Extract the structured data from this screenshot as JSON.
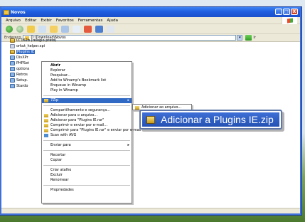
{
  "window": {
    "title": "Novos"
  },
  "titlebar_buttons": [
    "_",
    "□",
    "X"
  ],
  "menu": [
    "Arquivo",
    "Editar",
    "Exibir",
    "Favoritos",
    "Ferramentas",
    "Ajuda"
  ],
  "address": {
    "label": "Endereço",
    "value": "D:\\Download\\Novos",
    "go_label": "Ir"
  },
  "files": [
    {
      "name": "LC162b (relogio preto)",
      "icon": "zip-icon"
    },
    {
      "name": "orkut_helper.xpi",
      "icon": "xpi-icon"
    },
    {
      "name": "Plugins IE",
      "icon": "zip-icon",
      "selected": true
    },
    {
      "name": "DivXPr",
      "icon": "exe-icon"
    },
    {
      "name": "PHPSet",
      "icon": "exe-icon"
    },
    {
      "name": "options",
      "icon": "exe-icon"
    },
    {
      "name": "Retros",
      "icon": "exe-icon"
    },
    {
      "name": "Setup.",
      "icon": "exe-icon"
    },
    {
      "name": "Stardo",
      "icon": "exe-icon"
    }
  ],
  "context_menu": {
    "items": [
      {
        "label": "Abrir",
        "bold": true
      },
      {
        "label": "Explorar"
      },
      {
        "label": "Pesquisar..."
      },
      {
        "label": "Add to Winamp's Bookmark list"
      },
      {
        "label": "Enqueue in Winamp"
      },
      {
        "label": "Play in Winamp"
      },
      {
        "sep": true
      },
      {
        "label": "7Zip",
        "icon": "zip-icon",
        "arrow": "▸",
        "highlighted": true
      },
      {
        "sep": true
      },
      {
        "label": "Compartilhamento e segurança..."
      },
      {
        "label": "Adicionar para o arquivo...",
        "icon": "zip-icon"
      },
      {
        "label": "Adicionar para \"Plugins IE.rar\"",
        "icon": "zip-icon"
      },
      {
        "label": "Comprimir e enviar por e-mail...",
        "icon": "zip-icon"
      },
      {
        "label": "Comprimir para \"Plugins IE.rar\" e enviar por e-mail",
        "icon": "zip-icon"
      },
      {
        "label": "Scan with AVG",
        "icon": "scan-icon"
      },
      {
        "sep": true
      },
      {
        "label": "Enviar para",
        "arrow": "▸"
      },
      {
        "sep": true
      },
      {
        "label": "Recortar"
      },
      {
        "label": "Copiar"
      },
      {
        "sep": true
      },
      {
        "label": "Criar atalho"
      },
      {
        "label": "Excluir"
      },
      {
        "label": "Renomear"
      },
      {
        "sep": true
      },
      {
        "label": "Propriedades"
      }
    ]
  },
  "submenu": {
    "label": "Adicionar ao arquivo..."
  },
  "callout": {
    "label": "Adicionar a Plugins IE.zip"
  }
}
